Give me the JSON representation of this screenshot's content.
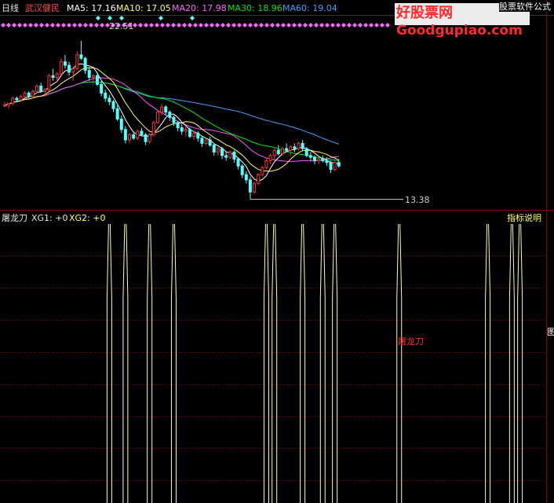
{
  "header": {
    "period": "日线",
    "stock_name": "武汉健民",
    "ma5": "MA5: 17.16",
    "ma10": "MA10: 17.05",
    "ma20": "MA20: 17.98",
    "ma30": "MA30: 18.96",
    "ma60": "MA60: 19.04"
  },
  "watermark": {
    "site_cn": "好股票网",
    "site_en": "Goodgupiao.com",
    "tag": "股票软件公式"
  },
  "price_panel": {
    "high_label": "22.51",
    "low_label": "13.38"
  },
  "indicator_panel": {
    "name": "屠龙刀",
    "xg1": "XG1: +0",
    "xg2": "XG2: +0",
    "help_button": "指标说明",
    "center_text": "屠龙刀",
    "right_edge_char": "图"
  },
  "colors": {
    "background": "#000000",
    "grid": "#8b0000",
    "up_candle": "#ff3030",
    "down_candle": "#54ffff",
    "ma5": "#ffffff",
    "ma10": "#ffff54",
    "ma20": "#ff55ff",
    "ma30": "#00e600",
    "ma60": "#3aa0ff",
    "signal_line": "#ffffaa"
  },
  "chart_data": {
    "type": "candlestick",
    "title": "日线 武汉健民",
    "ylim": [
      13.0,
      23.5
    ],
    "candles": [
      [
        18.8,
        19.0,
        18.7,
        18.8
      ],
      [
        18.8,
        18.9,
        18.6,
        18.9
      ],
      [
        18.9,
        19.3,
        18.8,
        19.2
      ],
      [
        19.2,
        19.3,
        19.0,
        19.1
      ],
      [
        19.1,
        19.4,
        19.0,
        19.3
      ],
      [
        19.3,
        19.6,
        19.2,
        19.5
      ],
      [
        19.5,
        19.6,
        19.2,
        19.3
      ],
      [
        19.3,
        19.7,
        19.2,
        19.6
      ],
      [
        19.6,
        20.0,
        19.5,
        19.9
      ],
      [
        19.9,
        20.1,
        19.5,
        19.6
      ],
      [
        19.6,
        19.8,
        19.3,
        19.7
      ],
      [
        19.7,
        20.6,
        19.6,
        20.5
      ],
      [
        20.5,
        20.9,
        20.2,
        20.4
      ],
      [
        20.4,
        20.7,
        20.1,
        20.6
      ],
      [
        20.6,
        21.5,
        20.5,
        21.3
      ],
      [
        21.3,
        21.7,
        20.9,
        21.1
      ],
      [
        21.1,
        21.3,
        20.5,
        20.7
      ],
      [
        20.7,
        21.0,
        20.2,
        20.9
      ],
      [
        20.9,
        21.9,
        20.8,
        21.7
      ],
      [
        21.7,
        22.51,
        21.4,
        21.5
      ],
      [
        21.5,
        21.6,
        20.6,
        20.8
      ],
      [
        20.8,
        21.0,
        20.2,
        20.4
      ],
      [
        20.4,
        20.6,
        20.0,
        20.5
      ],
      [
        20.5,
        20.7,
        19.9,
        20.0
      ],
      [
        20.0,
        20.2,
        19.3,
        19.5
      ],
      [
        19.5,
        19.7,
        19.0,
        19.2
      ],
      [
        19.2,
        19.4,
        18.8,
        19.0
      ],
      [
        19.0,
        19.1,
        18.4,
        18.6
      ],
      [
        18.6,
        18.8,
        17.9,
        18.0
      ],
      [
        18.0,
        18.2,
        17.2,
        17.4
      ],
      [
        17.4,
        17.6,
        16.6,
        16.8
      ],
      [
        16.8,
        17.2,
        16.6,
        17.1
      ],
      [
        17.1,
        17.3,
        16.8,
        16.9
      ],
      [
        16.9,
        17.4,
        16.8,
        17.3
      ],
      [
        17.3,
        17.5,
        17.0,
        17.1
      ],
      [
        17.1,
        17.2,
        16.5,
        16.7
      ],
      [
        16.7,
        17.2,
        16.6,
        17.1
      ],
      [
        17.1,
        17.9,
        17.0,
        17.8
      ],
      [
        17.8,
        18.5,
        17.7,
        18.4
      ],
      [
        18.4,
        18.9,
        18.2,
        18.7
      ],
      [
        18.7,
        18.8,
        18.2,
        18.4
      ],
      [
        18.4,
        18.5,
        17.9,
        18.1
      ],
      [
        18.1,
        18.2,
        17.6,
        17.8
      ],
      [
        17.8,
        17.9,
        17.3,
        17.5
      ],
      [
        17.5,
        17.7,
        17.1,
        17.3
      ],
      [
        17.3,
        17.6,
        17.0,
        17.4
      ],
      [
        17.4,
        17.5,
        16.9,
        17.0
      ],
      [
        17.0,
        17.3,
        16.8,
        17.2
      ],
      [
        17.2,
        17.3,
        16.7,
        16.9
      ],
      [
        16.9,
        17.0,
        16.4,
        16.6
      ],
      [
        16.6,
        16.9,
        16.5,
        16.8
      ],
      [
        16.8,
        17.0,
        16.4,
        16.5
      ],
      [
        16.5,
        16.6,
        15.9,
        16.1
      ],
      [
        16.1,
        16.4,
        15.9,
        16.3
      ],
      [
        16.3,
        16.4,
        15.7,
        15.9
      ],
      [
        15.9,
        16.1,
        15.6,
        15.8
      ],
      [
        15.8,
        16.2,
        15.7,
        16.1
      ],
      [
        16.1,
        16.2,
        15.5,
        15.7
      ],
      [
        15.7,
        15.8,
        15.1,
        15.3
      ],
      [
        15.3,
        15.4,
        14.6,
        14.8
      ],
      [
        14.8,
        15.0,
        14.3,
        14.5
      ],
      [
        14.5,
        14.7,
        13.38,
        13.8
      ],
      [
        13.8,
        14.4,
        13.7,
        14.3
      ],
      [
        14.3,
        14.9,
        14.2,
        14.8
      ],
      [
        14.8,
        15.3,
        14.7,
        15.2
      ],
      [
        15.2,
        15.7,
        15.1,
        15.6
      ],
      [
        15.6,
        16.0,
        15.4,
        15.9
      ],
      [
        15.9,
        16.3,
        15.7,
        16.2
      ],
      [
        16.2,
        16.5,
        15.9,
        16.0
      ],
      [
        16.0,
        16.4,
        15.9,
        16.3
      ],
      [
        16.3,
        16.6,
        16.1,
        16.2
      ],
      [
        16.2,
        16.5,
        15.9,
        16.4
      ],
      [
        16.4,
        16.6,
        16.1,
        16.3
      ],
      [
        16.3,
        16.7,
        16.2,
        16.6
      ],
      [
        16.6,
        16.8,
        16.2,
        16.3
      ],
      [
        16.3,
        16.4,
        15.8,
        15.9
      ],
      [
        15.9,
        16.1,
        15.6,
        15.8
      ],
      [
        15.8,
        15.9,
        15.4,
        15.6
      ],
      [
        15.6,
        15.8,
        15.4,
        15.7
      ],
      [
        15.7,
        15.9,
        15.5,
        15.6
      ],
      [
        15.6,
        15.8,
        15.3,
        15.5
      ],
      [
        15.5,
        15.6,
        14.9,
        15.1
      ],
      [
        15.1,
        15.6,
        15.0,
        15.5
      ],
      [
        15.5,
        15.7,
        15.2,
        15.3
      ]
    ],
    "signal_bars": [
      26,
      30,
      36,
      42,
      65,
      67,
      74,
      79,
      82,
      98,
      120,
      126,
      128
    ],
    "indicator_ylim": [
      0,
      1
    ]
  }
}
